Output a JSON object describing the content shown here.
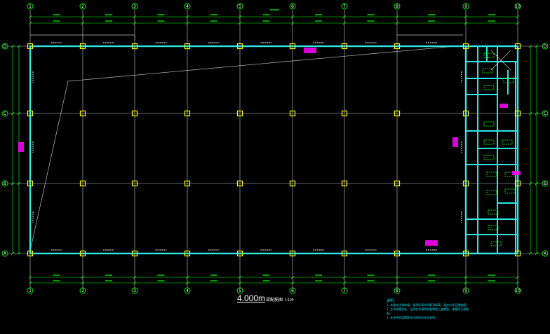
{
  "drawing": {
    "title": "4.000m",
    "subtitle": "梁配筋图",
    "scale": "1:100"
  },
  "grid": {
    "columns": [
      "1",
      "2",
      "3",
      "4",
      "5",
      "6",
      "7",
      "8",
      "9",
      "10"
    ],
    "rows": [
      "D",
      "C",
      "B",
      "A"
    ]
  },
  "notes": {
    "heading": "说明：",
    "lines": [
      "1. 本图未注明的梁，梁顶标高均同板顶标高，梁定位详见建施图。",
      "2. 主次梁相交处，主梁在次梁两侧各附加三道箍筋，规格同主梁箍筋。",
      "3. 未注明的梁腰筋详见结构设计总说明。"
    ]
  },
  "colors": {
    "background": "#000000",
    "beam": "#2ee6e6",
    "grid_line": "#c8c8c8",
    "dimension": "#00ff00",
    "column": "#ffff00",
    "annotation": "#ff00ff",
    "label": "#ffffff"
  }
}
